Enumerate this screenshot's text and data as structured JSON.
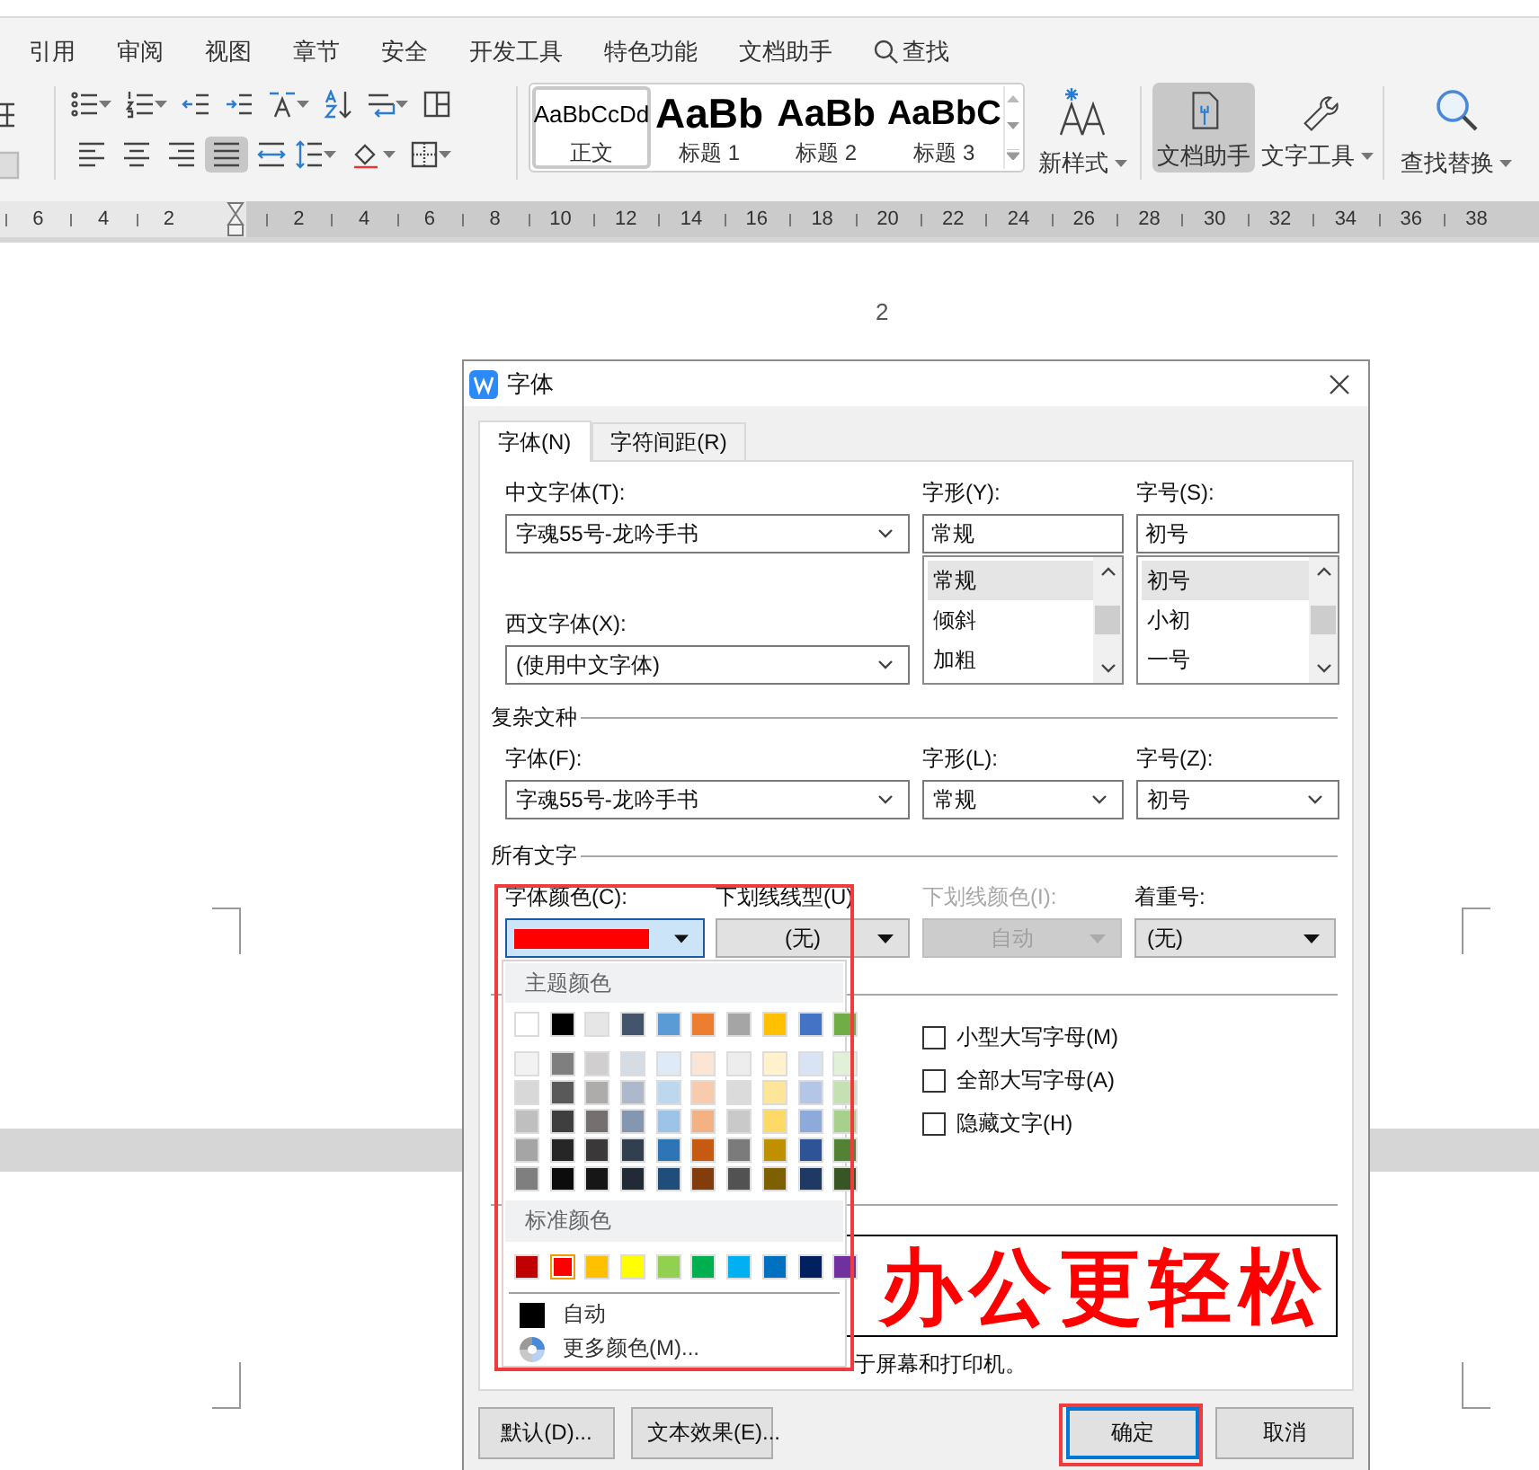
{
  "menu_tabs": [
    "引用",
    "审阅",
    "视图",
    "章节",
    "安全",
    "开发工具",
    "特色功能",
    "文档助手"
  ],
  "search_tab": {
    "label": "查找"
  },
  "ribbon": {
    "alignment": [
      {
        "kind": "left",
        "selected": false
      },
      {
        "kind": "center",
        "selected": false
      },
      {
        "kind": "right",
        "selected": false
      },
      {
        "kind": "justify",
        "selected": true
      },
      {
        "kind": "distributed",
        "selected": false
      }
    ],
    "style_gallery": [
      {
        "preview": "AaBbCcDd",
        "name": "正文",
        "selected": true
      },
      {
        "preview": "AaBb",
        "name": "标题 1",
        "selected": false
      },
      {
        "preview": "AaBb",
        "name": "标题 2",
        "selected": false
      },
      {
        "preview": "AaBbC",
        "name": "标题 3",
        "selected": false
      }
    ],
    "new_style": {
      "label": "新样式"
    },
    "tools": [
      {
        "kind": "doc",
        "label": "文档助手",
        "selected": true
      },
      {
        "kind": "wrench",
        "label": "文字工具",
        "selected": false
      }
    ],
    "find_replace": {
      "label": "查找替换"
    }
  },
  "ruler": {
    "left_labels": [
      "6",
      "4",
      "2"
    ],
    "right_labels": [
      "2",
      "4",
      "6",
      "8",
      "10",
      "12",
      "14",
      "16",
      "18",
      "20",
      "22",
      "24",
      "26",
      "28",
      "30",
      "32",
      "34",
      "36",
      "38"
    ]
  },
  "document": {
    "page_number": "2"
  },
  "dialog": {
    "title": "字体",
    "tabs": [
      {
        "label": "字体(N)",
        "selected": true
      },
      {
        "label": "字符间距(R)",
        "selected": false
      }
    ],
    "chinese_font": {
      "label": "中文字体(T):",
      "value": "字魂55号-龙吟手书"
    },
    "style": {
      "label": "字形(Y):",
      "value": "常规",
      "options": [
        {
          "label": "常规",
          "selected": true
        },
        {
          "label": "倾斜",
          "selected": false
        },
        {
          "label": "加粗",
          "selected": false
        }
      ]
    },
    "size": {
      "label": "字号(S):",
      "value": "初号",
      "options": [
        {
          "label": "初号",
          "selected": true
        },
        {
          "label": "小初",
          "selected": false
        },
        {
          "label": "一号",
          "selected": false
        }
      ]
    },
    "western_font": {
      "label": "西文字体(X):",
      "value": "(使用中文字体)"
    },
    "complex_script": {
      "title": "复杂文种",
      "font": {
        "label": "字体(F):",
        "value": "字魂55号-龙吟手书"
      },
      "style": {
        "label": "字形(L):",
        "value": "常规"
      },
      "size": {
        "label": "字号(Z):",
        "value": "初号"
      }
    },
    "all_text": {
      "title": "所有文字",
      "font_color": {
        "label": "字体颜色(C):",
        "color": "#ff0000",
        "disabled": false
      },
      "underline_style": {
        "label": "下划线线型(U)",
        "value": "(无)",
        "disabled": false
      },
      "underline_color": {
        "label": "下划线颜色(I):",
        "value": "自动",
        "disabled": true
      },
      "emphasis": {
        "label": "着重号:",
        "value": "(无)",
        "disabled": false
      }
    },
    "effects": [
      {
        "label": "小型大写字母(M)",
        "checked": false
      },
      {
        "label": "全部大写字母(A)",
        "checked": false
      },
      {
        "label": "隐藏文字(H)",
        "checked": false
      }
    ],
    "preview": {
      "sample": "办公更轻松",
      "note": "于屏幕和打印机。"
    },
    "buttons": [
      {
        "label": "默认(D)...",
        "default": false
      },
      {
        "label": "文本效果(E)...",
        "default": false
      },
      {
        "label": "确定",
        "default": true
      },
      {
        "label": "取消",
        "default": false
      }
    ]
  },
  "color_menu": {
    "theme_title": "主题颜色",
    "theme_colors": [
      {
        "color": "#ffffff",
        "selected": false
      },
      {
        "color": "#000000",
        "selected": false
      },
      {
        "color": "#e7e6e6",
        "selected": false
      },
      {
        "color": "#44546a",
        "selected": false
      },
      {
        "color": "#5b9bd5",
        "selected": false
      },
      {
        "color": "#ed7d31",
        "selected": false
      },
      {
        "color": "#a5a5a5",
        "selected": false
      },
      {
        "color": "#ffc000",
        "selected": false
      },
      {
        "color": "#4472c4",
        "selected": false
      },
      {
        "color": "#70ad47",
        "selected": false
      }
    ],
    "shades": [
      [
        {
          "color": "#f2f2f2",
          "selected": false
        },
        {
          "color": "#7f7f7f",
          "selected": false
        },
        {
          "color": "#d0cece",
          "selected": false
        },
        {
          "color": "#d6dce4",
          "selected": false
        },
        {
          "color": "#deebf6",
          "selected": false
        },
        {
          "color": "#fbe5d5",
          "selected": false
        },
        {
          "color": "#ededed",
          "selected": false
        },
        {
          "color": "#fff2cc",
          "selected": false
        },
        {
          "color": "#dae3f3",
          "selected": false
        },
        {
          "color": "#e2efd9",
          "selected": false
        }
      ],
      [
        {
          "color": "#d8d8d8",
          "selected": false
        },
        {
          "color": "#595959",
          "selected": false
        },
        {
          "color": "#aeabab",
          "selected": false
        },
        {
          "color": "#adb9ca",
          "selected": false
        },
        {
          "color": "#bdd7ee",
          "selected": false
        },
        {
          "color": "#f7cbac",
          "selected": false
        },
        {
          "color": "#dbdbdb",
          "selected": false
        },
        {
          "color": "#fee599",
          "selected": false
        },
        {
          "color": "#b4c6e7",
          "selected": false
        },
        {
          "color": "#c5e0b3",
          "selected": false
        }
      ],
      [
        {
          "color": "#bfbfbf",
          "selected": false
        },
        {
          "color": "#3f3f3f",
          "selected": false
        },
        {
          "color": "#757070",
          "selected": false
        },
        {
          "color": "#8496b0",
          "selected": false
        },
        {
          "color": "#9dc3e6",
          "selected": false
        },
        {
          "color": "#f4b183",
          "selected": false
        },
        {
          "color": "#c9c9c9",
          "selected": false
        },
        {
          "color": "#ffd965",
          "selected": false
        },
        {
          "color": "#8eaadb",
          "selected": false
        },
        {
          "color": "#a8d08d",
          "selected": false
        }
      ],
      [
        {
          "color": "#a5a5a5",
          "selected": false
        },
        {
          "color": "#262626",
          "selected": false
        },
        {
          "color": "#3a3838",
          "selected": false
        },
        {
          "color": "#323f4f",
          "selected": false
        },
        {
          "color": "#2e75b5",
          "selected": false
        },
        {
          "color": "#c55a11",
          "selected": false
        },
        {
          "color": "#7b7b7b",
          "selected": false
        },
        {
          "color": "#bf9000",
          "selected": false
        },
        {
          "color": "#2f5496",
          "selected": false
        },
        {
          "color": "#538135",
          "selected": false
        }
      ],
      [
        {
          "color": "#7f7f7f",
          "selected": false
        },
        {
          "color": "#0c0c0c",
          "selected": false
        },
        {
          "color": "#171616",
          "selected": false
        },
        {
          "color": "#222a35",
          "selected": false
        },
        {
          "color": "#1e4e79",
          "selected": false
        },
        {
          "color": "#833c0b",
          "selected": false
        },
        {
          "color": "#525252",
          "selected": false
        },
        {
          "color": "#7f6000",
          "selected": false
        },
        {
          "color": "#1f3864",
          "selected": false
        },
        {
          "color": "#375623",
          "selected": false
        }
      ]
    ],
    "standard_title": "标准颜色",
    "standard_colors": [
      {
        "color": "#c00000",
        "selected": false
      },
      {
        "color": "#ff0000",
        "selected": true
      },
      {
        "color": "#ffc000",
        "selected": false
      },
      {
        "color": "#ffff00",
        "selected": false
      },
      {
        "color": "#92d050",
        "selected": false
      },
      {
        "color": "#00b050",
        "selected": false
      },
      {
        "color": "#00b0f0",
        "selected": false
      },
      {
        "color": "#0070c0",
        "selected": false
      },
      {
        "color": "#002060",
        "selected": false
      },
      {
        "color": "#7030a0",
        "selected": false
      }
    ],
    "automatic": {
      "label": "自动",
      "color": "#000000"
    },
    "more": {
      "label": "更多颜色(M)..."
    }
  }
}
